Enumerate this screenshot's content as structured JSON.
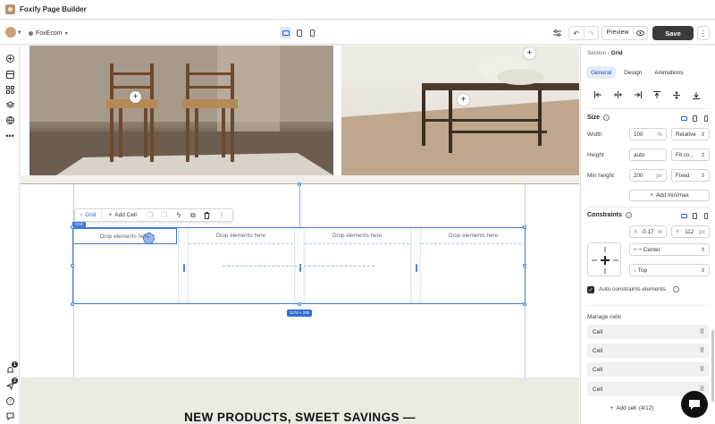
{
  "app": {
    "title": "Foxify Page Builder"
  },
  "toolbar": {
    "store_name": "FoxEcom",
    "preview_label": "Preview",
    "save_label": "Save"
  },
  "rail": {
    "notification_counts": [
      "1",
      "2"
    ]
  },
  "canvas": {
    "floatbar": {
      "back_label": "Grid",
      "add_cell_label": "Add Cell"
    },
    "grid_tag": "Grid",
    "cells": [
      "Drop elements here",
      "Drop elements here",
      "Drop elements here",
      "Drop elements here"
    ],
    "size_readout": "1170 × 200",
    "headline": "NEW PRODUCTS, SWEET SAVINGS —"
  },
  "panel": {
    "breadcrumb": {
      "parent": "Section",
      "current": "Grid"
    },
    "tabs": [
      "General",
      "Design",
      "Animations"
    ],
    "size": {
      "title": "Size",
      "width_label": "Width",
      "width_value": "100",
      "width_unit": "%",
      "width_mode": "Relative",
      "height_label": "Height",
      "height_value": "auto",
      "height_mode": "Fit co...",
      "minh_label": "Min height",
      "minh_value": "200",
      "minh_unit": "px",
      "minh_mode": "Fixed",
      "add_minmax": "Add min/max"
    },
    "constraints": {
      "title": "Constraints",
      "x_label": "X",
      "x_value": "-0.17",
      "x_unit": "%",
      "y_label": "Y",
      "y_value": "112",
      "y_unit": "px",
      "horizontal": "Center",
      "vertical": "Top",
      "auto_label": "Auto constraints elements"
    },
    "manage_cells": {
      "title": "Manage cells",
      "items": [
        "Cell",
        "Cell",
        "Cell",
        "Cell"
      ],
      "add_label": "Add cell",
      "add_count": "(4/12)"
    }
  },
  "colors": {
    "accent": "#3d7ae0",
    "save_bg": "#3a3a3a",
    "active_tab": "#1d4ed8"
  },
  "icons": [
    "add-icon",
    "layout-icon",
    "apps-icon",
    "layers-icon",
    "database-icon",
    "more-icon",
    "bell-icon",
    "send-icon",
    "help-icon",
    "chat-icon"
  ]
}
